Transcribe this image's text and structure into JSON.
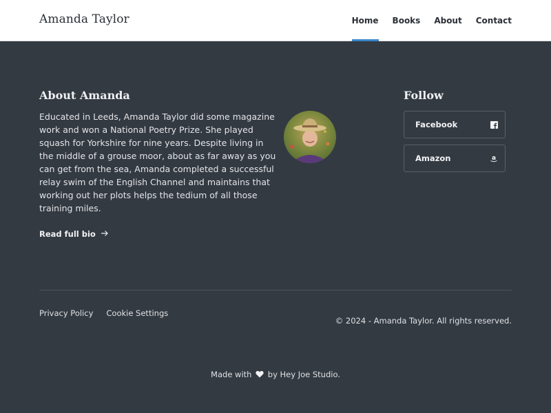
{
  "header": {
    "brand": "Amanda Taylor",
    "nav": [
      {
        "label": "Home",
        "active": true
      },
      {
        "label": "Books"
      },
      {
        "label": "About"
      },
      {
        "label": "Contact"
      }
    ],
    "accent_color": "#3a86c8"
  },
  "about": {
    "title": "About Amanda",
    "text": "Educated in Leeds, Amanda Taylor did some magazine work and won a National Poetry Prize. She played squash for Yorkshire for nine years. Despite living in the middle of a grouse moor, about as far away as you can get from the sea, Amanda completed a successful relay swim of the English Channel and maintains that working out her plots helps the tedium of all those training miles.",
    "read_more": "Read full bio",
    "read_more_icon": "arrow-right-icon"
  },
  "follow": {
    "title": "Follow",
    "links": [
      {
        "label": "Facebook",
        "icon": "facebook-icon"
      },
      {
        "label": "Amazon",
        "icon": "amazon-icon"
      }
    ]
  },
  "footer": {
    "links": [
      "Privacy Policy",
      "Cookie Settings"
    ],
    "copyright": "© 2024 - Amanda Taylor. All rights reserved.",
    "made_prefix": "Made with",
    "made_suffix": "by Hey Joe Studio.",
    "made_icon": "heart-icon"
  },
  "colors": {
    "background": "#343a42",
    "header_bg": "#ffffff"
  }
}
